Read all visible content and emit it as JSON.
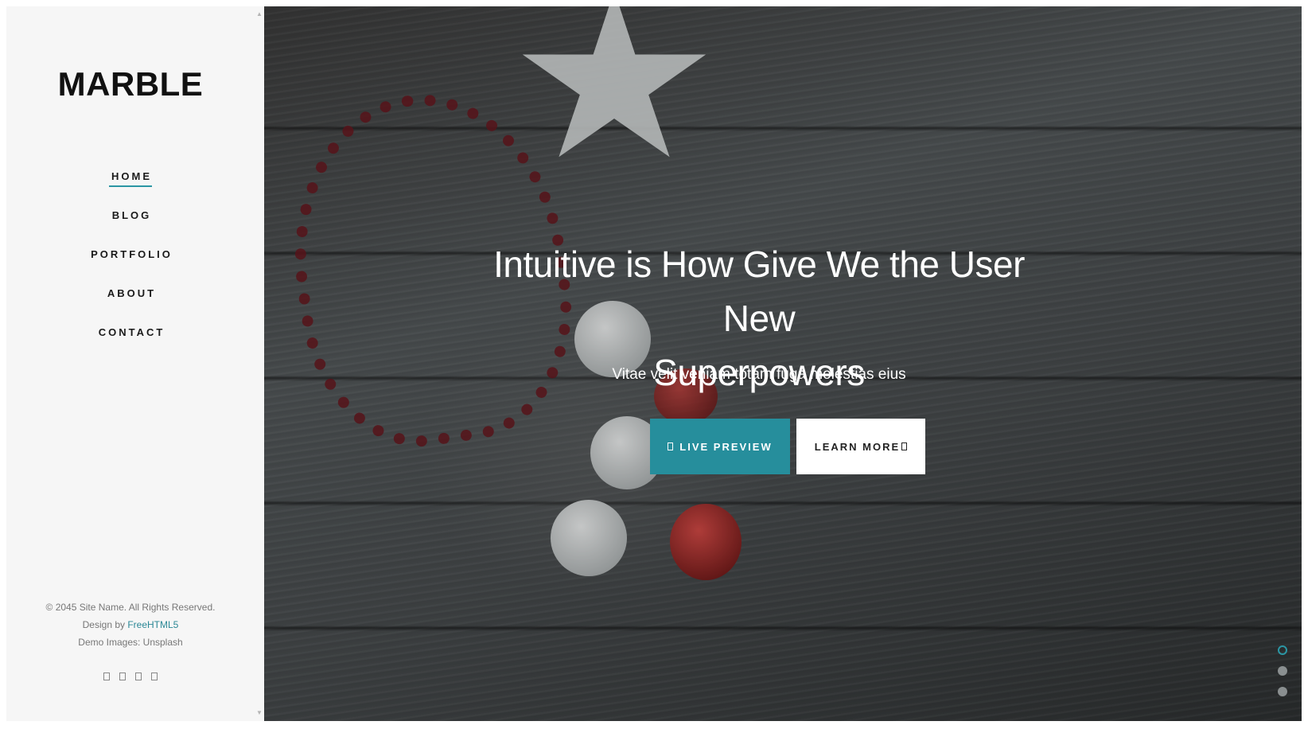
{
  "sidebar": {
    "logo": "MARBLE",
    "nav": [
      {
        "label": "HOME",
        "active": true
      },
      {
        "label": "BLOG",
        "active": false
      },
      {
        "label": "PORTFOLIO",
        "active": false
      },
      {
        "label": "ABOUT",
        "active": false
      },
      {
        "label": "CONTACT",
        "active": false
      }
    ],
    "footer": {
      "copyright": "© 2045 Site Name. All Rights Reserved.",
      "design_prefix": "Design by ",
      "design_link": "FreeHTML5",
      "demo_images": "Demo Images: Unsplash"
    },
    "social_icons": [
      "social-icon-1",
      "social-icon-2",
      "social-icon-3",
      "social-icon-4"
    ]
  },
  "hero": {
    "headline_line1": "Intuitive is How Give We the User New",
    "headline_line2": "Superpowers",
    "subheading": "Vitae velit veniam totam fuga molestias eius",
    "primary_button": "LIVE PREVIEW",
    "secondary_button": "LEARN MORE",
    "slides": {
      "count": 3,
      "active_index": 0
    }
  },
  "colors": {
    "accent": "#268e9c",
    "sidebar_bg": "#f6f6f6",
    "text_dark": "#111111"
  }
}
